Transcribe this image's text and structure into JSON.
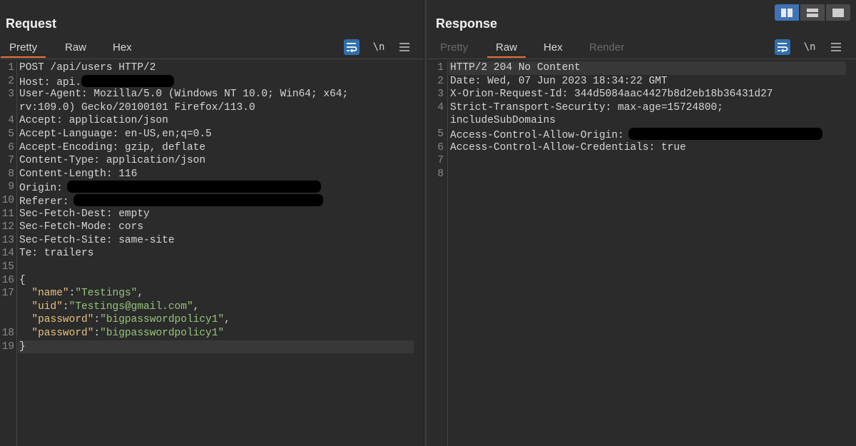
{
  "request": {
    "title": "Request",
    "tabs": [
      "Pretty",
      "Raw",
      "Hex"
    ],
    "active_tab": "Pretty",
    "newline_label": "\\n",
    "lines": [
      {
        "n": "1",
        "text": "POST /api/users HTTP/2"
      },
      {
        "n": "2",
        "text": "Host: api."
      },
      {
        "n": "3",
        "text": "User-Agent: Mozilla/5.0 (Windows NT 10.0; Win64; x64;"
      },
      {
        "n": "",
        "text": "rv:109.0) Gecko/20100101 Firefox/113.0"
      },
      {
        "n": "4",
        "text": "Accept: application/json"
      },
      {
        "n": "5",
        "text": "Accept-Language: en-US,en;q=0.5"
      },
      {
        "n": "6",
        "text": "Accept-Encoding: gzip, deflate"
      },
      {
        "n": "7",
        "text": "Content-Type: application/json"
      },
      {
        "n": "8",
        "text": "Content-Length: 116"
      },
      {
        "n": "9",
        "text": "Origin:"
      },
      {
        "n": "10",
        "text": "Referer:"
      },
      {
        "n": "11",
        "text": "Sec-Fetch-Dest: empty"
      },
      {
        "n": "12",
        "text": "Sec-Fetch-Mode: cors"
      },
      {
        "n": "13",
        "text": "Sec-Fetch-Site: same-site"
      },
      {
        "n": "14",
        "text": "Te: trailers"
      },
      {
        "n": "15",
        "text": ""
      },
      {
        "n": "16",
        "text": "{"
      },
      {
        "n": "17",
        "key": "\"name\"",
        "value": "\"Testings\"",
        "comma": ","
      },
      {
        "n": "",
        "key": "\"uid\"",
        "value": "\"Testings@gmail.com\"",
        "comma": ","
      },
      {
        "n": "",
        "key": "\"password\"",
        "value": "\"bigpasswordpolicy1\"",
        "comma": ","
      },
      {
        "n": "18",
        "key": "\"password\"",
        "value": "\"bigpasswordpolicy1\"",
        "comma": ""
      },
      {
        "n": "19",
        "text": "}"
      }
    ]
  },
  "response": {
    "title": "Response",
    "tabs": [
      "Pretty",
      "Raw",
      "Hex",
      "Render"
    ],
    "active_tab": "Raw",
    "disabled_tabs": [
      "Pretty",
      "Render"
    ],
    "newline_label": "\\n",
    "lines": [
      {
        "n": "1",
        "text": "HTTP/2 204 No Content"
      },
      {
        "n": "2",
        "text": "Date: Wed, 07 Jun 2023 18:34:22 GMT"
      },
      {
        "n": "3",
        "text": "X-Orion-Request-Id: 344d5084aac4427b8d2eb18b36431d27"
      },
      {
        "n": "4",
        "text": "Strict-Transport-Security: max-age=15724800;"
      },
      {
        "n": "",
        "text": "includeSubDomains"
      },
      {
        "n": "5",
        "text": "Access-Control-Allow-Origin:"
      },
      {
        "n": "6",
        "text": "Access-Control-Allow-Credentials: true"
      },
      {
        "n": "7",
        "text": ""
      },
      {
        "n": "8",
        "text": ""
      }
    ]
  },
  "colors": {
    "background": "#2b2b2b",
    "accent_tab": "#e8743b",
    "active_button": "#2f6fad",
    "json_key": "#e6c07b",
    "json_string": "#98c379",
    "redaction": "#000000"
  },
  "icons": [
    "wrap-lines-icon",
    "menu-icon",
    "layout-side-by-side-icon",
    "layout-stacked-icon",
    "layout-single-icon"
  ]
}
